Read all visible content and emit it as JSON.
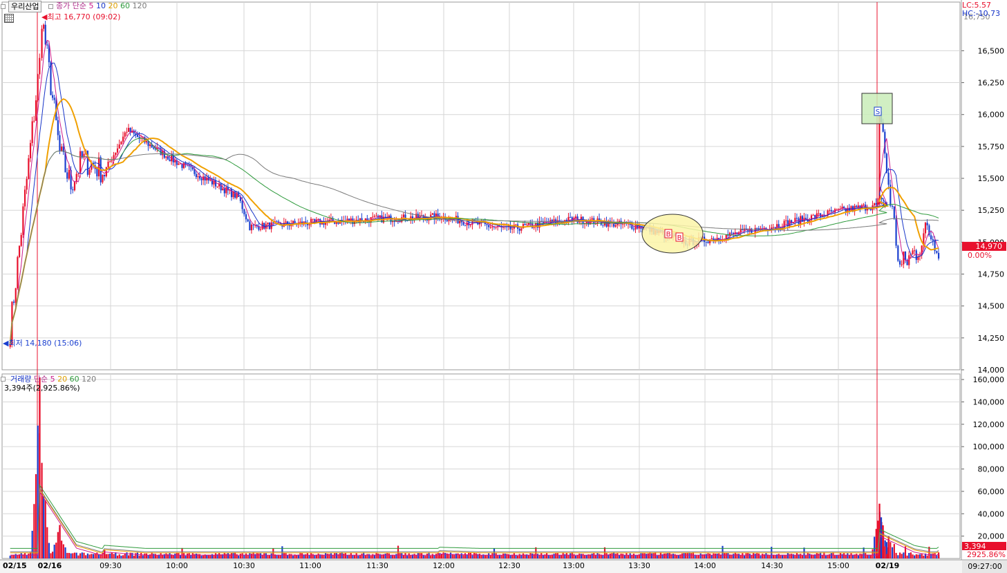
{
  "header": {
    "stock_name": "우리산업",
    "price_legend": [
      "종가",
      "단순",
      "5",
      "10",
      "20",
      "60",
      "120"
    ],
    "lc": "LC:5.57",
    "hc": "HC:-10.73",
    "high_marker": "최고 16,770 (09:02)",
    "low_marker": "최저 14,180 (15:06)"
  },
  "volume_header": {
    "legend": [
      "거래량",
      "단순",
      "5",
      "20",
      "60",
      "120"
    ],
    "current": "3,394주(2,925.86%)"
  },
  "price_axis": {
    "ticks": [
      "16,500",
      "16,250",
      "16,000",
      "15,750",
      "15,500",
      "15,250",
      "15,000",
      "14,750",
      "14,500",
      "14,250",
      "14,000"
    ],
    "top_partial": "16,750",
    "current_price": "14,970",
    "current_change": "0.00%"
  },
  "volume_axis": {
    "ticks": [
      "160,000",
      "140,000",
      "120,000",
      "100,000",
      "80,000",
      "60,000",
      "40,000",
      "20,000"
    ],
    "current_volume": "3,394",
    "current_ratio": "2925.86%"
  },
  "time_axis": {
    "labels": [
      "02/15",
      "02/16",
      "09:30",
      "10:00",
      "10:30",
      "11:00",
      "11:30",
      "12:00",
      "12:30",
      "13:00",
      "13:30",
      "14:00",
      "14:30",
      "15:00",
      "02/19"
    ],
    "end_time": "09:27:00"
  },
  "signals": {
    "sell": "S",
    "buy1": "B",
    "buy2": "B"
  },
  "colors": {
    "up": "#e8102c",
    "down": "#1a3fcf",
    "ma5": "#cc1a8c",
    "ma10": "#1533c8",
    "ma20": "#f0a000",
    "ma60": "#2e9a3c",
    "ma120": "#7a7a7a",
    "grid": "#d6d6d6",
    "buy_ellipse": "#fbf4a8",
    "sell_box": "#c9ecb8"
  },
  "chart_data": {
    "type": "candlestick",
    "instrument": "우리산업",
    "price_axis": {
      "ylim": [
        14000,
        16800
      ]
    },
    "volume_axis": {
      "ylim": [
        0,
        165000
      ]
    },
    "close_path": [
      {
        "t": "02/15 15:06",
        "close": 14180
      },
      {
        "t": "02/16 09:01",
        "close": 16400
      },
      {
        "t": "02/16 09:02",
        "close": 16770
      },
      {
        "t": "02/16 09:10",
        "close": 15700
      },
      {
        "t": "02/16 09:15",
        "close": 15450
      },
      {
        "t": "02/16 09:20",
        "close": 15650
      },
      {
        "t": "02/16 09:30",
        "close": 15550
      },
      {
        "t": "02/16 09:40",
        "close": 15880
      },
      {
        "t": "02/16 10:00",
        "close": 15650
      },
      {
        "t": "02/16 10:15",
        "close": 15500
      },
      {
        "t": "02/16 10:30",
        "close": 15350
      },
      {
        "t": "02/16 10:35",
        "close": 15120
      },
      {
        "t": "02/16 11:00",
        "close": 15150
      },
      {
        "t": "02/16 11:30",
        "close": 15180
      },
      {
        "t": "02/16 12:00",
        "close": 15200
      },
      {
        "t": "02/16 12:30",
        "close": 15100
      },
      {
        "t": "02/16 13:00",
        "close": 15180
      },
      {
        "t": "02/16 13:30",
        "close": 15120
      },
      {
        "t": "02/16 13:50",
        "close": 15000
      },
      {
        "t": "02/16 14:00",
        "close": 15020
      },
      {
        "t": "02/16 14:30",
        "close": 15130
      },
      {
        "t": "02/16 15:00",
        "close": 15250
      },
      {
        "t": "02/16 15:20",
        "close": 15300
      },
      {
        "t": "02/19 09:01",
        "close": 16050
      },
      {
        "t": "02/19 09:05",
        "close": 15450
      },
      {
        "t": "02/19 09:10",
        "close": 14800
      },
      {
        "t": "02/19 09:18",
        "close": 14950
      },
      {
        "t": "02/19 09:22",
        "close": 15100
      },
      {
        "t": "02/19 09:27",
        "close": 14970
      }
    ],
    "volume_path": [
      {
        "t": "02/16 09:01",
        "volume": 162000
      },
      {
        "t": "02/16 09:02",
        "volume": 64000
      },
      {
        "t": "02/16 09:10",
        "volume": 30000
      },
      {
        "t": "02/16 09:30",
        "volume": 8000
      },
      {
        "t": "02/16 12:00",
        "volume": 3000
      },
      {
        "t": "02/16 15:20",
        "volume": 4000
      },
      {
        "t": "02/19 09:01",
        "volume": 49000
      },
      {
        "t": "02/19 09:05",
        "volume": 20000
      },
      {
        "t": "02/19 09:27",
        "volume": 3394
      }
    ]
  }
}
